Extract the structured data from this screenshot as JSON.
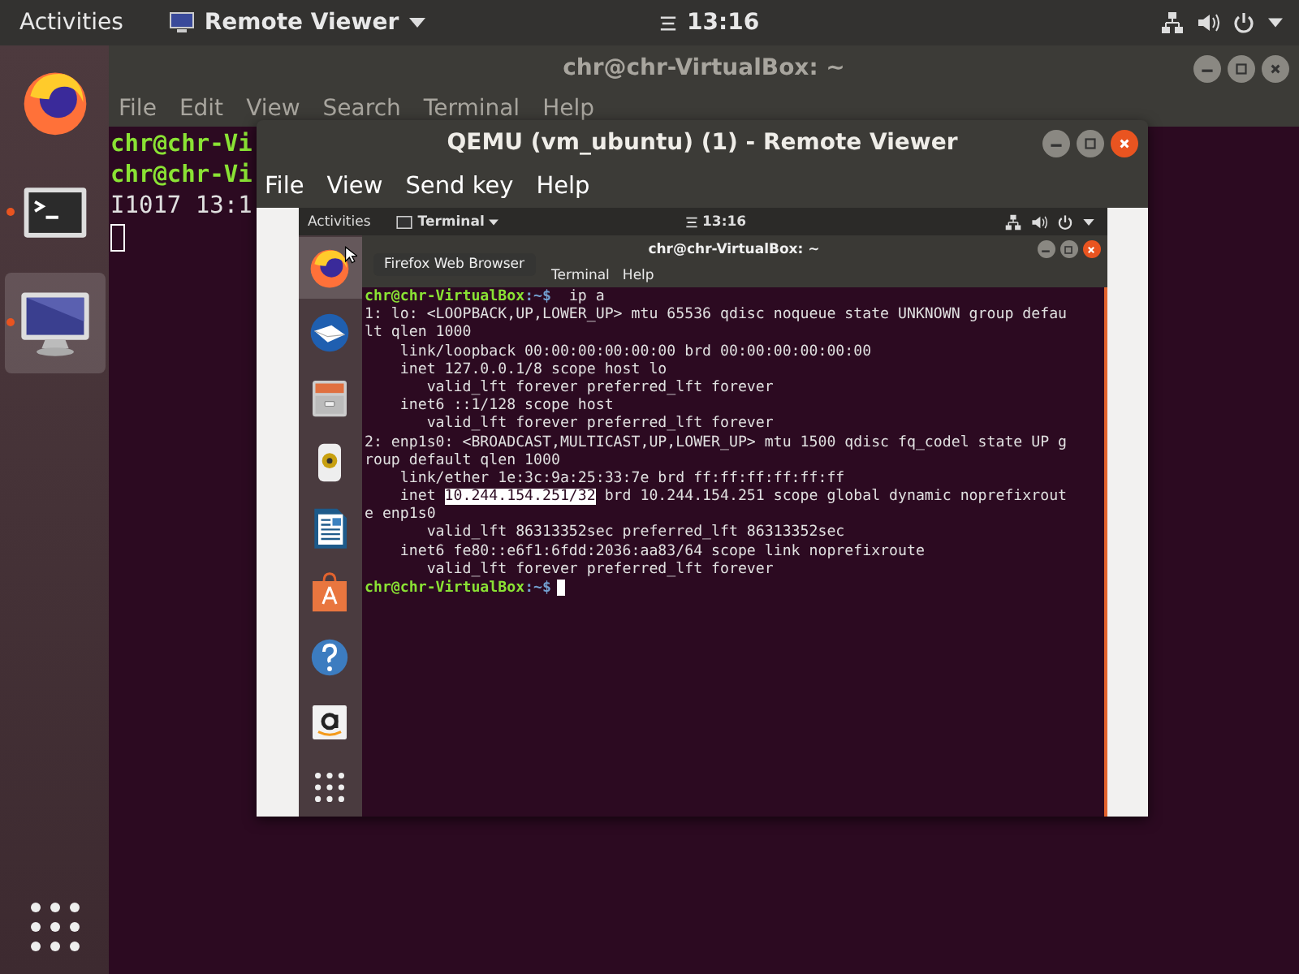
{
  "top_bar": {
    "activities": "Activities",
    "app_menu": "Remote Viewer",
    "clock": "13:16"
  },
  "dock": {
    "items": [
      {
        "kind": "firefox",
        "running": false,
        "selected": false
      },
      {
        "kind": "terminal",
        "running": true,
        "selected": false
      },
      {
        "kind": "monitor",
        "running": true,
        "selected": true
      }
    ]
  },
  "terminal_window": {
    "title": "chr@chr-VirtualBox: ~",
    "focused": false,
    "menu": [
      "File",
      "Edit",
      "View",
      "Search",
      "Terminal",
      "Help"
    ],
    "lines": [
      {
        "kind": "prompt",
        "user": "chr@chr-Vi",
        "cursor": false
      },
      {
        "kind": "prompt",
        "user": "chr@chr-Vi",
        "cursor": false
      },
      {
        "kind": "output",
        "text": "I1017 13:1"
      },
      {
        "kind": "cursor"
      }
    ]
  },
  "remote_viewer": {
    "title": "QEMU (vm_ubuntu) (1) - Remote Viewer",
    "menu": [
      "File",
      "View",
      "Send key",
      "Help"
    ],
    "guest": {
      "top_bar": {
        "activities": "Activities",
        "app_menu": "Terminal",
        "clock": "13:16"
      },
      "dock": {
        "items": [
          {
            "kind": "firefox",
            "selected": true
          },
          {
            "kind": "mail",
            "selected": false
          },
          {
            "kind": "files",
            "selected": false
          },
          {
            "kind": "speaker",
            "selected": false
          },
          {
            "kind": "document",
            "selected": false
          },
          {
            "kind": "bag",
            "selected": false
          },
          {
            "kind": "help",
            "selected": false
          },
          {
            "kind": "amazon",
            "selected": false
          }
        ]
      },
      "tooltip": "Firefox Web Browser",
      "terminal": {
        "title": "chr@chr-VirtualBox: ~",
        "focused": true,
        "menu": [
          "Terminal",
          "Help"
        ],
        "lines": [
          {
            "kind": "prompt",
            "user": "chr@chr-VirtualBox",
            "path": ":~$",
            "command": "  ip a",
            "cursor": false
          },
          {
            "kind": "output",
            "text": "1: lo: <LOOPBACK,UP,LOWER_UP> mtu 65536 qdisc noqueue state UNKNOWN group defau"
          },
          {
            "kind": "output",
            "text": "lt qlen 1000"
          },
          {
            "kind": "output",
            "text": "    link/loopback 00:00:00:00:00:00 brd 00:00:00:00:00:00"
          },
          {
            "kind": "output",
            "text": "    inet 127.0.0.1/8 scope host lo"
          },
          {
            "kind": "output",
            "text": "       valid_lft forever preferred_lft forever"
          },
          {
            "kind": "output",
            "text": "    inet6 ::1/128 scope host"
          },
          {
            "kind": "output",
            "text": "       valid_lft forever preferred_lft forever"
          },
          {
            "kind": "output",
            "text": "2: enp1s0: <BROADCAST,MULTICAST,UP,LOWER_UP> mtu 1500 qdisc fq_codel state UP g"
          },
          {
            "kind": "output",
            "text": "roup default qlen 1000"
          },
          {
            "kind": "output",
            "text": "    link/ether 1e:3c:9a:25:33:7e brd ff:ff:ff:ff:ff:ff"
          },
          {
            "kind": "selection",
            "before": "    inet ",
            "selected": "10.244.154.251/32",
            "after": " brd 10.244.154.251 scope global dynamic noprefixrout"
          },
          {
            "kind": "output",
            "text": "e enp1s0"
          },
          {
            "kind": "output",
            "text": "       valid_lft 86313352sec preferred_lft 86313352sec"
          },
          {
            "kind": "output",
            "text": "    inet6 fe80::e6f1:6fdd:2036:aa83/64 scope link noprefixroute"
          },
          {
            "kind": "output",
            "text": "       valid_lft forever preferred_lft forever"
          },
          {
            "kind": "prompt",
            "user": "chr@chr-VirtualBox",
            "path": ":~$",
            "cursor": true
          }
        ]
      }
    }
  }
}
